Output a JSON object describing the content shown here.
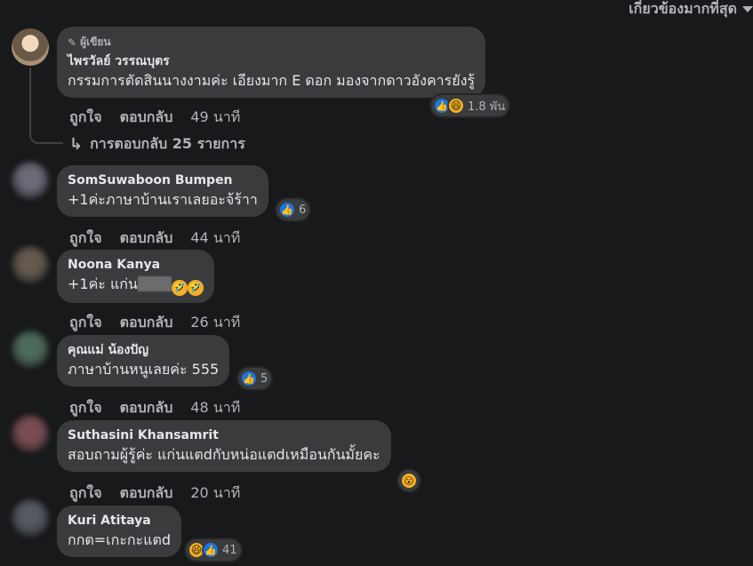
{
  "sort_label": "เกี่ยวข้องมากที่สุด",
  "main_comment": {
    "author_badge": "ผู้เขียน",
    "name": "ไพรวัลย์ วรรณบุตร",
    "text": "กรรมการตัดสินนางงามค่ะ เอียงมาก E ดอก มองจากดาวอังคารยังรู้",
    "reaction_count": "1.8 พัน",
    "reactions": [
      "like-icon",
      "haha-icon"
    ],
    "like_label": "ถูกใจ",
    "reply_label": "ตอบกลับ",
    "time": "49 นาที",
    "replies_link": "การตอบกลับ 25 รายการ"
  },
  "comments": [
    {
      "name": "SomSuwaboon Bumpen",
      "text": "+1ค่ะภาษาบ้านเราเลยอะจ้ร้าา",
      "reaction_count": "6",
      "like_label": "ถูกใจ",
      "reply_label": "ตอบกลับ",
      "time": "44 นาที"
    },
    {
      "name": "Noona Kanya",
      "text": "+1ค่ะ แก่น",
      "like_label": "ถูกใจ",
      "reply_label": "ตอบกลับ",
      "time": "26 นาที"
    },
    {
      "name": "คุณแม่ น้องปัญ",
      "text": "ภาษาบ้านหนูเลยค่ะ 555",
      "reaction_count": "5",
      "like_label": "ถูกใจ",
      "reply_label": "ตอบกลับ",
      "time": "48 นาที"
    },
    {
      "name": "Suthasini Khansamrit",
      "text": "สอบถามผู้รู้ค่ะ แก่นแตdกับหน่อแตdเหมือนกันมั้ยคะ",
      "like_label": "ถูกใจ",
      "reply_label": "ตอบกลับ",
      "time": "20 นาที"
    },
    {
      "name": "Kuri Atitaya",
      "text": "กกต=เกะกะแตd",
      "reaction_count": "41"
    }
  ],
  "icons": {
    "like": "👍",
    "haha": "😆",
    "wow": "😮",
    "rofl": "🤣",
    "pencil": "✎",
    "reply_arrow": "↳"
  },
  "colors": {
    "background": "#18191a",
    "bubble": "#3a3b3c",
    "text": "#e4e6eb",
    "secondary_text": "#b0b3b8",
    "like_blue": "#1b74e4",
    "emoji_yellow": "#f7b125"
  }
}
